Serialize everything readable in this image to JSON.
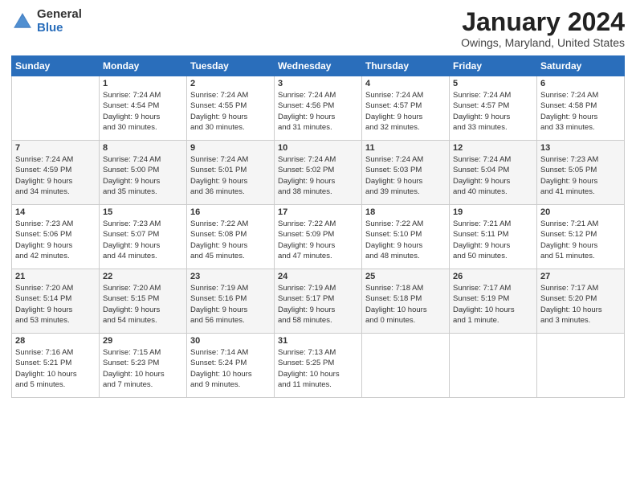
{
  "header": {
    "logo_general": "General",
    "logo_blue": "Blue",
    "title": "January 2024",
    "location": "Owings, Maryland, United States"
  },
  "weekdays": [
    "Sunday",
    "Monday",
    "Tuesday",
    "Wednesday",
    "Thursday",
    "Friday",
    "Saturday"
  ],
  "weeks": [
    [
      {
        "day": "",
        "info": ""
      },
      {
        "day": "1",
        "info": "Sunrise: 7:24 AM\nSunset: 4:54 PM\nDaylight: 9 hours\nand 30 minutes."
      },
      {
        "day": "2",
        "info": "Sunrise: 7:24 AM\nSunset: 4:55 PM\nDaylight: 9 hours\nand 30 minutes."
      },
      {
        "day": "3",
        "info": "Sunrise: 7:24 AM\nSunset: 4:56 PM\nDaylight: 9 hours\nand 31 minutes."
      },
      {
        "day": "4",
        "info": "Sunrise: 7:24 AM\nSunset: 4:57 PM\nDaylight: 9 hours\nand 32 minutes."
      },
      {
        "day": "5",
        "info": "Sunrise: 7:24 AM\nSunset: 4:57 PM\nDaylight: 9 hours\nand 33 minutes."
      },
      {
        "day": "6",
        "info": "Sunrise: 7:24 AM\nSunset: 4:58 PM\nDaylight: 9 hours\nand 33 minutes."
      }
    ],
    [
      {
        "day": "7",
        "info": "Sunrise: 7:24 AM\nSunset: 4:59 PM\nDaylight: 9 hours\nand 34 minutes."
      },
      {
        "day": "8",
        "info": "Sunrise: 7:24 AM\nSunset: 5:00 PM\nDaylight: 9 hours\nand 35 minutes."
      },
      {
        "day": "9",
        "info": "Sunrise: 7:24 AM\nSunset: 5:01 PM\nDaylight: 9 hours\nand 36 minutes."
      },
      {
        "day": "10",
        "info": "Sunrise: 7:24 AM\nSunset: 5:02 PM\nDaylight: 9 hours\nand 38 minutes."
      },
      {
        "day": "11",
        "info": "Sunrise: 7:24 AM\nSunset: 5:03 PM\nDaylight: 9 hours\nand 39 minutes."
      },
      {
        "day": "12",
        "info": "Sunrise: 7:24 AM\nSunset: 5:04 PM\nDaylight: 9 hours\nand 40 minutes."
      },
      {
        "day": "13",
        "info": "Sunrise: 7:23 AM\nSunset: 5:05 PM\nDaylight: 9 hours\nand 41 minutes."
      }
    ],
    [
      {
        "day": "14",
        "info": "Sunrise: 7:23 AM\nSunset: 5:06 PM\nDaylight: 9 hours\nand 42 minutes."
      },
      {
        "day": "15",
        "info": "Sunrise: 7:23 AM\nSunset: 5:07 PM\nDaylight: 9 hours\nand 44 minutes."
      },
      {
        "day": "16",
        "info": "Sunrise: 7:22 AM\nSunset: 5:08 PM\nDaylight: 9 hours\nand 45 minutes."
      },
      {
        "day": "17",
        "info": "Sunrise: 7:22 AM\nSunset: 5:09 PM\nDaylight: 9 hours\nand 47 minutes."
      },
      {
        "day": "18",
        "info": "Sunrise: 7:22 AM\nSunset: 5:10 PM\nDaylight: 9 hours\nand 48 minutes."
      },
      {
        "day": "19",
        "info": "Sunrise: 7:21 AM\nSunset: 5:11 PM\nDaylight: 9 hours\nand 50 minutes."
      },
      {
        "day": "20",
        "info": "Sunrise: 7:21 AM\nSunset: 5:12 PM\nDaylight: 9 hours\nand 51 minutes."
      }
    ],
    [
      {
        "day": "21",
        "info": "Sunrise: 7:20 AM\nSunset: 5:14 PM\nDaylight: 9 hours\nand 53 minutes."
      },
      {
        "day": "22",
        "info": "Sunrise: 7:20 AM\nSunset: 5:15 PM\nDaylight: 9 hours\nand 54 minutes."
      },
      {
        "day": "23",
        "info": "Sunrise: 7:19 AM\nSunset: 5:16 PM\nDaylight: 9 hours\nand 56 minutes."
      },
      {
        "day": "24",
        "info": "Sunrise: 7:19 AM\nSunset: 5:17 PM\nDaylight: 9 hours\nand 58 minutes."
      },
      {
        "day": "25",
        "info": "Sunrise: 7:18 AM\nSunset: 5:18 PM\nDaylight: 10 hours\nand 0 minutes."
      },
      {
        "day": "26",
        "info": "Sunrise: 7:17 AM\nSunset: 5:19 PM\nDaylight: 10 hours\nand 1 minute."
      },
      {
        "day": "27",
        "info": "Sunrise: 7:17 AM\nSunset: 5:20 PM\nDaylight: 10 hours\nand 3 minutes."
      }
    ],
    [
      {
        "day": "28",
        "info": "Sunrise: 7:16 AM\nSunset: 5:21 PM\nDaylight: 10 hours\nand 5 minutes."
      },
      {
        "day": "29",
        "info": "Sunrise: 7:15 AM\nSunset: 5:23 PM\nDaylight: 10 hours\nand 7 minutes."
      },
      {
        "day": "30",
        "info": "Sunrise: 7:14 AM\nSunset: 5:24 PM\nDaylight: 10 hours\nand 9 minutes."
      },
      {
        "day": "31",
        "info": "Sunrise: 7:13 AM\nSunset: 5:25 PM\nDaylight: 10 hours\nand 11 minutes."
      },
      {
        "day": "",
        "info": ""
      },
      {
        "day": "",
        "info": ""
      },
      {
        "day": "",
        "info": ""
      }
    ]
  ]
}
